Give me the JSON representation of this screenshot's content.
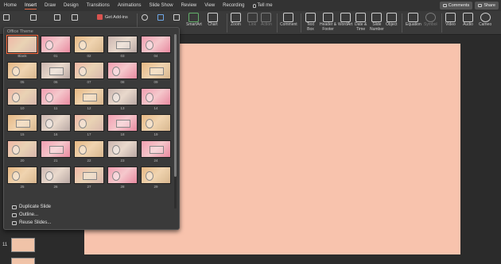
{
  "tabs": [
    "Home",
    "Insert",
    "Draw",
    "Design",
    "Transitions",
    "Animations",
    "Slide Show",
    "Review",
    "View",
    "Recording",
    "Tell me"
  ],
  "active_tab": "Insert",
  "top_buttons": {
    "comments": "Comments",
    "share": "Share"
  },
  "ribbon": {
    "get_addins": "Get Add-ins",
    "smartart": "SmartArt",
    "chart": "Chart",
    "zoom": "Zoom",
    "link": "Link",
    "action": "Action",
    "comment": "Comment",
    "text_box": "Text\nBox",
    "header_footer": "Header &\nFooter",
    "wordart": "WordArt",
    "date_time": "Date &\nTime",
    "slide_number": "Slide\nNumber",
    "object": "Object",
    "equation": "Equation",
    "symbol": "Symbol",
    "video": "Video",
    "audio": "Audio",
    "cameo": "Cameo"
  },
  "dropdown": {
    "title": "Office Theme",
    "layout_labels": [
      "Blank",
      "01",
      "02",
      "03",
      "04",
      "05",
      "06",
      "07",
      "08",
      "09",
      "10",
      "11",
      "12",
      "13",
      "14",
      "15",
      "16",
      "17",
      "18",
      "19",
      "20",
      "21",
      "22",
      "23",
      "24",
      "25",
      "26",
      "27",
      "28",
      "29"
    ],
    "menu": [
      "Duplicate Slide",
      "Outline...",
      "Reuse Slides..."
    ]
  },
  "left_pane": {
    "slide_number": "11"
  },
  "colors": {
    "slide_bg": "#f8c3ad",
    "accent": "#e26a45"
  }
}
